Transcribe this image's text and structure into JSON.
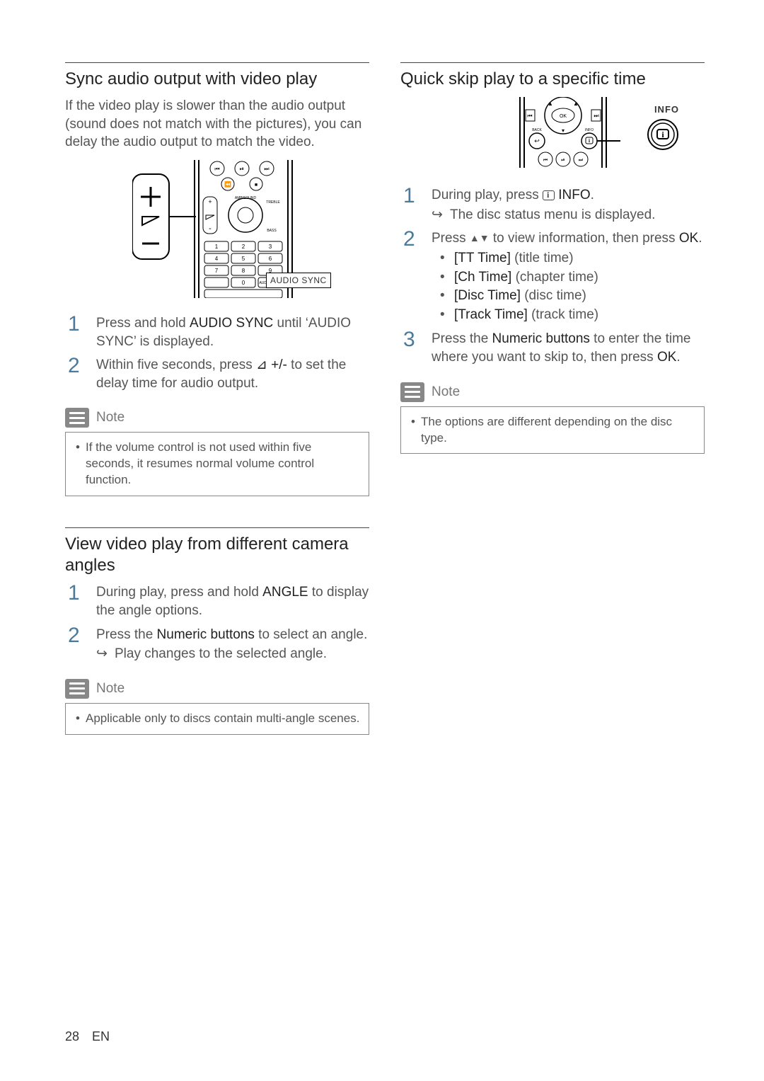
{
  "left": {
    "sec1": {
      "heading": "Sync audio output with video play",
      "intro": "If the video play is slower than the audio output (sound does not match with the pictures), you can delay the audio output to match the video.",
      "callout": "AUDIO SYNC",
      "step1a": "Press and hold ",
      "step1b": "AUDIO SYNC",
      "step1c": " until ‘AUDIO SYNC’ is displayed.",
      "step2a": "Within five seconds, press ",
      "step2b": "⊿ +/-",
      "step2c": " to set the delay time for audio output.",
      "noteLabel": "Note",
      "noteText": "If the volume control is not used within five seconds, it resumes normal volume control function."
    },
    "sec2": {
      "heading": "View video play from different camera angles",
      "step1a": "During play, press and hold ",
      "step1b": "ANGLE",
      "step1c": " to display the angle options.",
      "step2a": "Press the ",
      "step2b": "Numeric buttons",
      "step2c": " to select an angle.",
      "result": "Play changes to the selected angle.",
      "noteLabel": "Note",
      "noteText": "Applicable only to discs contain multi-angle scenes."
    }
  },
  "right": {
    "sec1": {
      "heading": "Quick skip play to a specific time",
      "callout": "INFO",
      "step1a": "During play, press ",
      "step1b": " INFO",
      "step1c": ".",
      "result1": "The disc status menu is displayed.",
      "step2a": "Press ",
      "step2b": " to view information, then press ",
      "step2c": "OK",
      "step2d": ".",
      "opt1b": "[TT Time]",
      "opt1t": " (title time)",
      "opt2b": "[Ch Time]",
      "opt2t": " (chapter time)",
      "opt3b": "[Disc Time]",
      "opt3t": " (disc time)",
      "opt4b": "[Track Time]",
      "opt4t": " (track time)",
      "step3a": "Press the ",
      "step3b": "Numeric buttons",
      "step3c": " to enter the time where you want to skip to, then press ",
      "step3d": "OK",
      "step3e": ".",
      "noteLabel": "Note",
      "noteText": "The options are different depending on the disc type."
    }
  },
  "footer": {
    "page": "28",
    "lang": "EN"
  },
  "remote": {
    "ambisound": "AMBISOUND",
    "treble": "TREBLE",
    "bass": "BASS",
    "audiosync": "AUDIO SYNC",
    "ok": "OK",
    "back": "BACK",
    "info": "INFO"
  }
}
